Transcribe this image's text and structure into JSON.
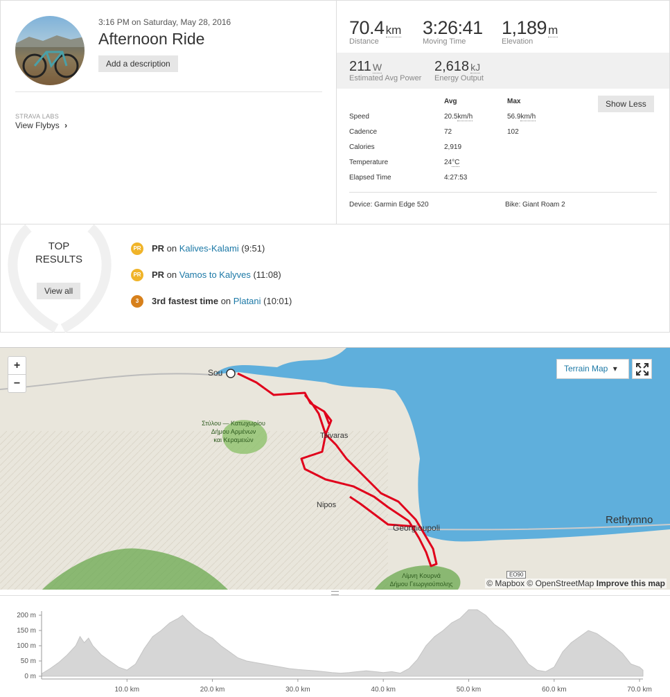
{
  "activity": {
    "datetime": "3:16 PM on Saturday, May 28, 2016",
    "title": "Afternoon Ride",
    "add_desc": "Add a description"
  },
  "labs": {
    "label": "STRAVA LABS",
    "link": "View Flybys",
    "chevron": "›"
  },
  "stats": {
    "distance": {
      "value": "70.4",
      "unit": "km",
      "label": "Distance"
    },
    "moving_time": {
      "value": "3:26:41",
      "label": "Moving Time"
    },
    "elevation": {
      "value": "1,189",
      "unit": "m",
      "label": "Elevation"
    },
    "power": {
      "value": "211",
      "unit": "W",
      "label": "Estimated Avg Power"
    },
    "energy": {
      "value": "2,618",
      "unit": "kJ",
      "label": "Energy Output"
    }
  },
  "more": {
    "show_less": "Show Less",
    "col_avg": "Avg",
    "col_max": "Max",
    "rows": [
      {
        "label": "Speed",
        "avg": "20.5",
        "avg_unit": "km/h",
        "max": "56.9",
        "max_unit": "km/h"
      },
      {
        "label": "Cadence",
        "avg": "72",
        "avg_unit": "",
        "max": "102",
        "max_unit": ""
      },
      {
        "label": "Calories",
        "avg": "2,919",
        "avg_unit": "",
        "max": "",
        "max_unit": ""
      },
      {
        "label": "Temperature",
        "avg": "24",
        "avg_unit": "°C",
        "max": "",
        "max_unit": ""
      },
      {
        "label": "Elapsed Time",
        "avg": "4:27:53",
        "avg_unit": "",
        "max": "",
        "max_unit": ""
      }
    ],
    "device": "Device: Garmin Edge 520",
    "bike": "Bike: Giant Roam 2"
  },
  "top_results": {
    "title_line1": "TOP",
    "title_line2": "RESULTS",
    "view_all": "View all",
    "items": [
      {
        "medal": "PR",
        "strong": "PR",
        "mid": " on ",
        "segment": "Kalives-Kalami",
        "time": " (9:51)",
        "color": "#f0b429"
      },
      {
        "medal": "PR",
        "strong": "PR",
        "mid": " on ",
        "segment": "Vamos to Kalyves",
        "time": " (11:08)",
        "color": "#f0b429"
      },
      {
        "medal": "3",
        "strong": "3rd fastest time",
        "mid": " on ",
        "segment": "Platani",
        "time": " (10:01)",
        "color": "#d7801b"
      }
    ]
  },
  "map": {
    "zoom_in": "+",
    "zoom_out": "−",
    "terrain": "Terrain Map",
    "terrain_caret": "▾",
    "fullscreen": "⤢",
    "places": {
      "souda": "Sou",
      "tsivaras": "Tsivaras",
      "nipos": "Nipos",
      "georgioupoli": "Georgioupoli",
      "rethymno": "Rethymno",
      "area1_l1": "Στύλου — Κατωχωρίου",
      "area1_l2": "Δήμου Αρμένων",
      "area1_l3": "και Κεραμειών",
      "lake_l1": "Λίμνη Κουρνά",
      "lake_l2": "Δήμου Γεωργιούπολης",
      "road": "EO90"
    },
    "attribution": "© Mapbox © OpenStreetMap",
    "improve": "Improve this map",
    "colors": {
      "sea": "#5fafdc",
      "land": "#e9e6dc",
      "route": "#e0001b",
      "green": "#8dc26b"
    }
  },
  "chart_data": {
    "type": "area",
    "ylabels": [
      "200 m",
      "150 m",
      "100 m",
      "50 m",
      "0 m"
    ],
    "yticks": [
      200,
      150,
      100,
      50,
      0
    ],
    "ylim": [
      0,
      200
    ],
    "xlabels": [
      "10.0 km",
      "20.0 km",
      "30.0 km",
      "40.0 km",
      "50.0 km",
      "60.0 km",
      "70.0 km"
    ],
    "xticks": [
      10,
      20,
      30,
      40,
      50,
      60,
      70
    ],
    "xlim": [
      0,
      70.4
    ],
    "x": [
      0,
      1,
      2,
      3,
      4,
      4.5,
      5,
      5.5,
      6,
      7,
      8,
      9,
      10,
      11,
      12,
      13,
      14,
      15,
      16,
      16.5,
      17,
      18,
      19,
      20,
      21,
      22,
      23,
      24,
      25,
      26,
      27,
      28,
      29,
      30,
      31,
      32,
      33,
      34,
      35,
      36,
      37,
      38,
      39,
      40,
      41,
      42,
      43,
      44,
      45,
      46,
      47,
      48,
      49,
      50,
      50.5,
      51,
      52,
      53,
      54,
      55,
      56,
      57,
      58,
      59,
      60,
      61,
      62,
      63,
      64,
      65,
      66,
      67,
      68,
      69,
      70,
      70.4
    ],
    "y": [
      8,
      25,
      45,
      70,
      100,
      130,
      110,
      125,
      100,
      70,
      50,
      30,
      20,
      40,
      90,
      130,
      150,
      175,
      190,
      200,
      185,
      160,
      140,
      125,
      100,
      80,
      60,
      50,
      45,
      40,
      35,
      30,
      25,
      22,
      20,
      18,
      15,
      12,
      10,
      12,
      15,
      18,
      15,
      12,
      15,
      10,
      25,
      55,
      100,
      130,
      150,
      175,
      190,
      220,
      230,
      225,
      200,
      170,
      150,
      120,
      80,
      40,
      20,
      15,
      30,
      80,
      110,
      130,
      150,
      140,
      120,
      100,
      75,
      40,
      30,
      20
    ]
  }
}
